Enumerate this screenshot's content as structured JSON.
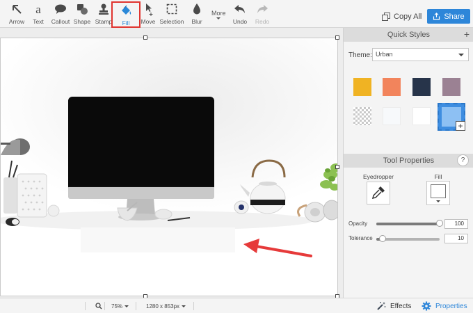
{
  "toolbar": {
    "tools": [
      {
        "id": "arrow",
        "label": "Arrow",
        "icon": "arrow-icon",
        "selected": false,
        "disabled": false
      },
      {
        "id": "text",
        "label": "Text",
        "icon": "text-icon",
        "selected": false,
        "disabled": false
      },
      {
        "id": "callout",
        "label": "Callout",
        "icon": "callout-icon",
        "selected": false,
        "disabled": false
      },
      {
        "id": "shape",
        "label": "Shape",
        "icon": "shape-icon",
        "selected": false,
        "disabled": false
      },
      {
        "id": "stamp",
        "label": "Stamp",
        "icon": "stamp-icon",
        "selected": false,
        "disabled": false
      },
      {
        "id": "fill",
        "label": "Fill",
        "icon": "fill-bucket-icon",
        "selected": true,
        "disabled": false
      },
      {
        "id": "move",
        "label": "Move",
        "icon": "move-icon",
        "selected": false,
        "disabled": false
      },
      {
        "id": "selection",
        "label": "Selection",
        "icon": "selection-icon",
        "selected": false,
        "disabled": false
      },
      {
        "id": "blur",
        "label": "Blur",
        "icon": "blur-icon",
        "selected": false,
        "disabled": false
      },
      {
        "id": "undo",
        "label": "Undo",
        "icon": "undo-icon",
        "selected": false,
        "disabled": false
      },
      {
        "id": "redo",
        "label": "Redo",
        "icon": "redo-icon",
        "selected": false,
        "disabled": true
      }
    ],
    "more_label": "More",
    "copy_all_label": "Copy All",
    "share_label": "Share"
  },
  "quick_styles": {
    "title": "Quick Styles",
    "theme_label": "Theme:",
    "theme_value": "Urban",
    "swatches": [
      {
        "color": "#f0b323"
      },
      {
        "color": "#f2845c"
      },
      {
        "color": "#27344a"
      },
      {
        "color": "#9b8193"
      },
      {
        "color": "transparent"
      },
      {
        "color": "#f7f9fb"
      },
      {
        "color": "#ffffff"
      },
      {
        "color": "#8dc0f3",
        "selected": true
      }
    ]
  },
  "tool_properties": {
    "title": "Tool Properties",
    "help_label": "?",
    "eyedropper_label": "Eyedropper",
    "fill_label": "Fill",
    "opacity": {
      "label": "Opacity",
      "value": "100",
      "fraction": 1.0
    },
    "tolerance": {
      "label": "Tolerance",
      "value": "10",
      "fraction": 0.1
    }
  },
  "statusbar": {
    "zoom": "75%",
    "dimensions": "1280 x 853px",
    "effects_label": "Effects",
    "properties_label": "Properties"
  },
  "colors": {
    "accent": "#2d86d9",
    "selection_highlight": "#e0342f",
    "annotation_arrow": "#e63a3a"
  }
}
